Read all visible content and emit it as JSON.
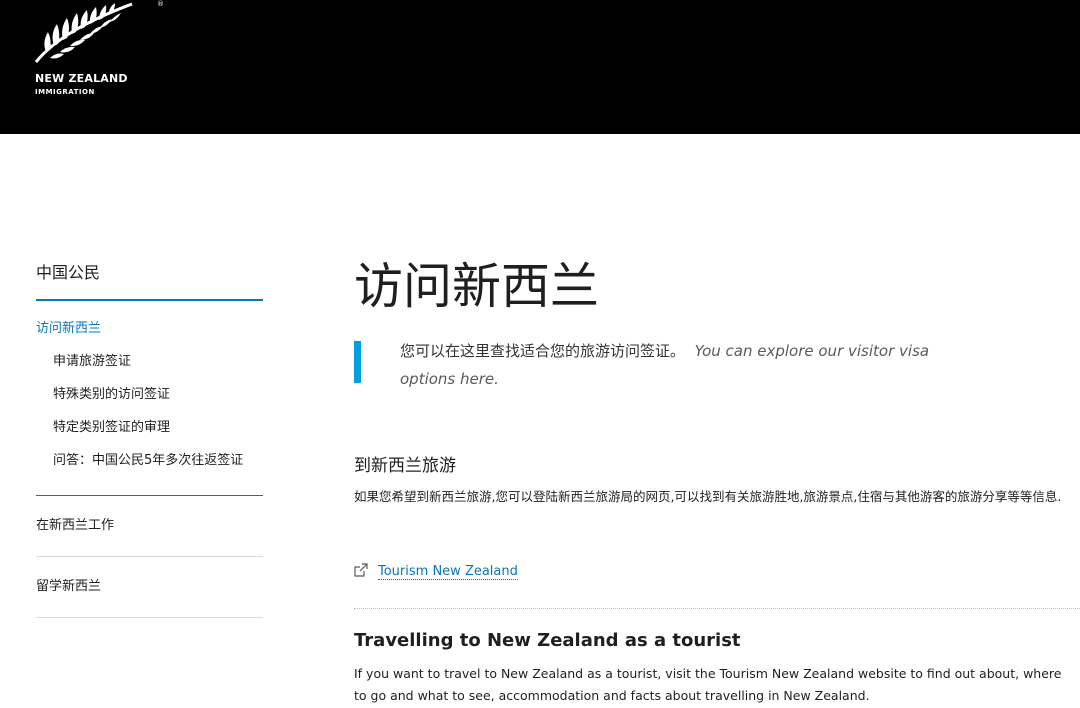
{
  "header": {
    "logo": {
      "name": "NEW ZEALAND",
      "sub": "IMMIGRATION",
      "reg": "®"
    }
  },
  "sidebar": {
    "heading": "中国公民",
    "active": "访问新西兰",
    "subitems": [
      "申请旅游签证",
      "特殊类别的访问签证",
      "特定类别签证的审理",
      "问答：中国公民5年多次往返签证"
    ],
    "items": [
      "在新西兰工作",
      "留学新西兰"
    ]
  },
  "main": {
    "title": "访问新西兰",
    "intro_cn": "您可以在这里查找适合您的旅游访问签证。",
    "intro_en": "You can explore our visitor visa options here.",
    "section_cn": {
      "heading": "到新西兰旅游",
      "body": "如果您希望到新西兰旅游,您可以登陆新西兰旅游局的网页,可以找到有关旅游胜地,旅游景点,住宿与其他游客的旅游分享等等信息.",
      "link": "Tourism New Zealand"
    },
    "section_en": {
      "heading": "Travelling to New Zealand as a tourist",
      "body": "If you want to travel to New Zealand as a tourist, visit the Tourism New Zealand website to find out about, where to go and what to see, accommodation and facts about travelling in New Zealand."
    }
  },
  "colors": {
    "header_bg": "#000000",
    "accent": "#0a76b7",
    "intro_bar": "#00a0df"
  },
  "icons": {
    "logo": "silver-fern-icon",
    "external_link": "external-link-icon"
  }
}
